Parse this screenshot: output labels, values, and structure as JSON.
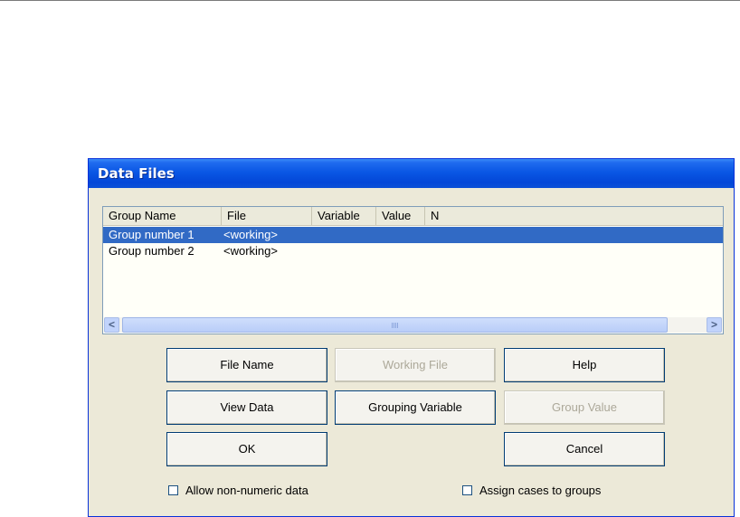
{
  "window": {
    "title": "Data Files"
  },
  "list": {
    "columns": [
      "Group Name",
      "File",
      "Variable",
      "Value",
      "N"
    ],
    "rows": [
      {
        "group_name": "Group number 1",
        "file": "<working>",
        "selected": true
      },
      {
        "group_name": "Group number 2",
        "file": "<working>",
        "selected": false
      }
    ]
  },
  "scrollbar": {
    "left_arrow": "<",
    "right_arrow": ">"
  },
  "buttons": {
    "file_name": "File Name",
    "working_file": "Working File",
    "help": "Help",
    "view_data": "View Data",
    "grouping_variable": "Grouping Variable",
    "group_value": "Group Value",
    "ok": "OK",
    "cancel": "Cancel"
  },
  "checkboxes": {
    "allow_non_numeric": {
      "label": "Allow non-numeric data",
      "checked": false
    },
    "assign_cases": {
      "label": "Assign cases to groups",
      "checked": false
    }
  },
  "colors": {
    "titlebar": "#0a57e4",
    "selection": "#316ac5",
    "dialog_bg": "#ece9d8"
  }
}
